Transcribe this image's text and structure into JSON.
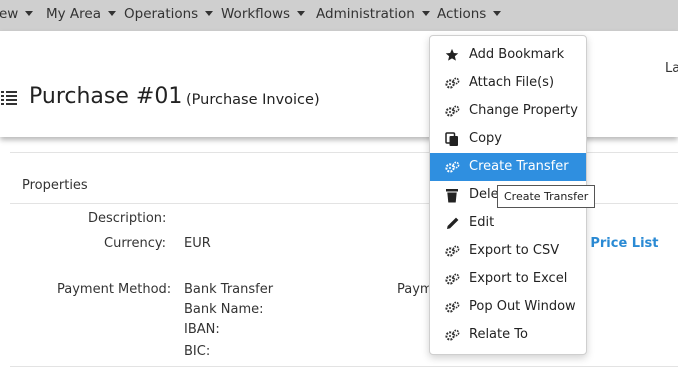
{
  "nav": {
    "items": [
      {
        "label": "ew"
      },
      {
        "label": "My Area"
      },
      {
        "label": "Operations"
      },
      {
        "label": "Workflows"
      },
      {
        "label": "Administration"
      },
      {
        "label": "Actions"
      }
    ]
  },
  "header": {
    "title": "Purchase #01",
    "subtitle": "(Purchase Invoice)",
    "right_partial": "La"
  },
  "properties": {
    "section_title": "Properties",
    "fields": [
      {
        "label": "Description:",
        "value": ""
      },
      {
        "label": "Currency:",
        "value": "EUR"
      },
      {
        "label": "Payment Method:",
        "value": "Bank Transfer"
      }
    ],
    "bank_lines": [
      "Bank Name:",
      "IBAN:",
      "BIC:"
    ],
    "partial_label": "Paym",
    "price_list_link": "e Price List"
  },
  "actions_menu": {
    "items": [
      {
        "label": "Add Bookmark",
        "icon": "star-icon"
      },
      {
        "label": "Attach File(s)",
        "icon": "gears-icon"
      },
      {
        "label": "Change Property",
        "icon": "gears-icon"
      },
      {
        "label": "Copy",
        "icon": "copy-icon"
      },
      {
        "label": "Create Transfer",
        "icon": "gears-icon",
        "active": true
      },
      {
        "label": "Dele",
        "icon": "trash-icon"
      },
      {
        "label": "Edit",
        "icon": "pencil-icon"
      },
      {
        "label": "Export to CSV",
        "icon": "gears-icon"
      },
      {
        "label": "Export to Excel",
        "icon": "gears-icon"
      },
      {
        "label": "Pop Out Window",
        "icon": "gears-icon"
      },
      {
        "label": "Relate To",
        "icon": "gears-icon"
      }
    ],
    "tooltip": "Create Transfer"
  },
  "colors": {
    "nav_background": "#cfcfcf",
    "active_item": "#2f8fe0",
    "link": "#2a8ad4"
  }
}
